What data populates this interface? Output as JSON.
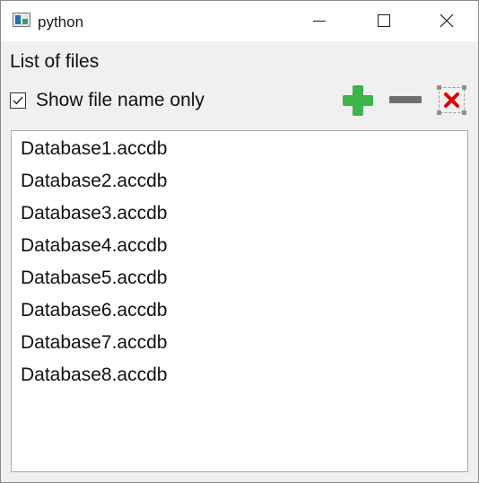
{
  "window": {
    "title": "python"
  },
  "header": {
    "label": "List of files"
  },
  "options": {
    "show_file_name_only_label": "Show file name only",
    "show_file_name_only_checked": true
  },
  "toolbar": {
    "add_icon": "plus-icon",
    "remove_icon": "minus-icon",
    "clear_icon": "delete-x-icon",
    "colors": {
      "add": "#3db34a",
      "remove": "#6f6f6f",
      "clear": "#e00000"
    }
  },
  "files": [
    "Database1.accdb",
    "Database2.accdb",
    "Database3.accdb",
    "Database4.accdb",
    "Database5.accdb",
    "Database6.accdb",
    "Database7.accdb",
    "Database8.accdb"
  ]
}
